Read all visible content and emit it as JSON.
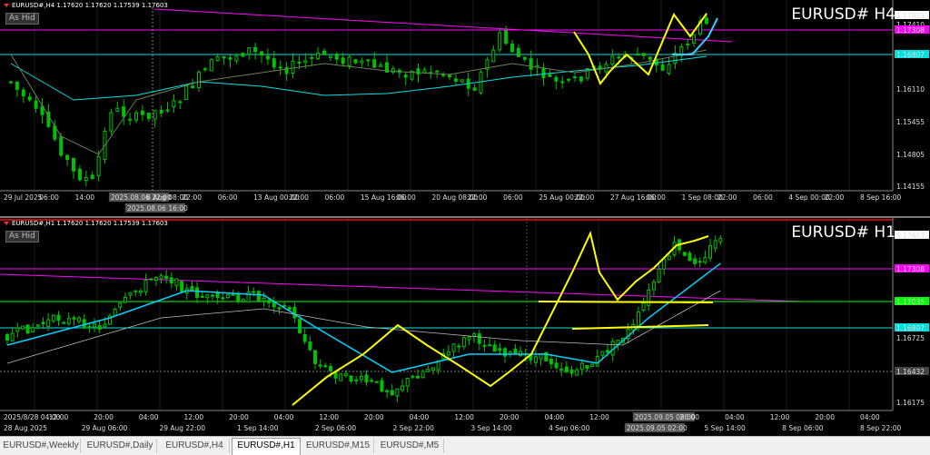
{
  "h4": {
    "ohlc_text": "EURUSD#,H4  1.17620 1.17620 1.17539 1.17603",
    "as_hide": "As Hid",
    "title": "EURUSD#  H4",
    "price_labels": [
      "1.17629",
      "1.17410",
      "1.17308",
      "1.16807",
      "1.16110",
      "1.15455",
      "1.14805",
      "1.14155"
    ],
    "time_labels": [
      "29 Jul 2025",
      "06:00",
      "14:00",
      "2025.08.06 22:00",
      "8 Aug 08:00",
      "22:00",
      "06:00",
      "13 Aug 00:00",
      "22:00",
      "06:00",
      "15 Aug 16:00",
      "06:00",
      "20 Aug 08:00",
      "22:00",
      "06:00",
      "25 Aug 00:00",
      "22:00",
      "27 Aug 16:00",
      "06:00",
      "1 Sep 08:00",
      "22:00",
      "06:00",
      "4 Sep 00:00",
      "22:00",
      "8 Sep 16:00"
    ],
    "crosshair_top": "2025.08.06 16:00",
    "crosshair_bottom": "2025.08.06 22:00"
  },
  "h1": {
    "ohlc_text": "EURUSD#,H1  1.17620 1.17620 1.17539 1.17603",
    "as_hide": "As Hid",
    "title": "EURUSD#  H1",
    "price_labels": [
      "1.17603",
      "1.17308",
      "1.17035",
      "1.16807",
      "1.16725",
      "1.16432",
      "1.16175"
    ],
    "time_labels": [
      "28 Aug 2025",
      "29 Aug 06:00",
      "29 Aug 22:00",
      "1 Sep 14:00",
      "2 Sep 06:00",
      "2 Sep 22:00",
      "3 Sep 14:00",
      "4 Sep 06:00",
      "2025.09.05 02:00",
      "5 Sep 14:00",
      "8 Sep 06:00",
      "8 Sep 22:00"
    ],
    "time_labels_top": [
      "2025/8/28 04:00",
      "12:00",
      "20:00",
      "04:00",
      "12:00",
      "20:00",
      "04:00",
      "12:00",
      "20:00",
      "04:00",
      "12:00",
      "20:00",
      "04:00",
      "12:00",
      "2025.09.05 08:00",
      "20:00",
      "04:00",
      "12:00",
      "20:00",
      "04:00"
    ],
    "crosshair_price": "1.16432"
  },
  "tabs": [
    {
      "label": "EURUSD#,Weekly",
      "active": false
    },
    {
      "label": "EURUSD#,Daily",
      "active": false
    },
    {
      "label": "EURUSD#,H4",
      "active": false
    },
    {
      "label": "EURUSD#,H1",
      "active": true
    },
    {
      "label": "EURUSD#,M15",
      "active": false
    },
    {
      "label": "EURUSD#,M5",
      "active": false
    }
  ],
  "colors": {
    "bull": "#00c000",
    "bear": "#00c000",
    "ma_fast": "#00d0ff",
    "ma_slow": "#6a7f55",
    "magenta": "#ff00ff",
    "cyan_line": "#00e0e0",
    "yellow": "#ffff00",
    "green_line": "#00ff00",
    "red_line": "#ff0000"
  }
}
